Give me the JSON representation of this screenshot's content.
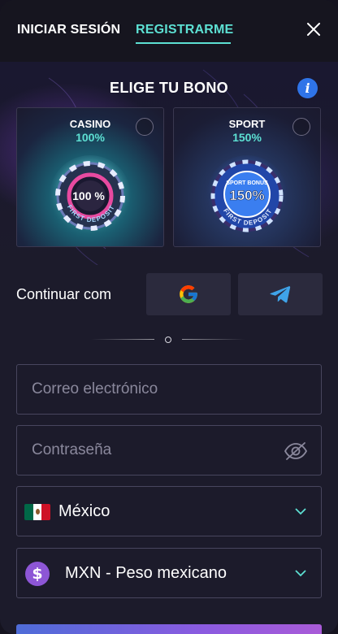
{
  "header": {
    "login_tab": "INICIAR SESIÓN",
    "register_tab": "REGISTRARME",
    "active_tab": "register",
    "accent_color": "#5de0d3"
  },
  "bonus": {
    "title": "ELIGE TU BONO",
    "info_icon": "info-icon",
    "options": [
      {
        "name": "CASINO",
        "percent": "100%",
        "selected": false,
        "chip_text": "100 %",
        "chip_ring_text": "FIRST DEPOSIT"
      },
      {
        "name": "SPORT",
        "percent": "150%",
        "selected": false,
        "chip_text_top": "SPORT BONUS",
        "chip_text": "150%",
        "chip_ring_text": "FIRST DEPOSIT"
      }
    ]
  },
  "social": {
    "label": "Continuar com",
    "providers": [
      "google-icon",
      "telegram-icon"
    ]
  },
  "divider": {},
  "form": {
    "email_placeholder": "Correo electrónico",
    "password_placeholder": "Contraseña",
    "country": {
      "value": "México",
      "flag": "mexico-flag"
    },
    "currency": {
      "value": "MXN - Peso mexicano",
      "icon": "dollar-icon"
    }
  },
  "colors": {
    "background": "#1c1b2b",
    "field_border": "#48465e",
    "button_gradient_start": "#4e6cd8",
    "button_gradient_end": "#a95bd8"
  }
}
